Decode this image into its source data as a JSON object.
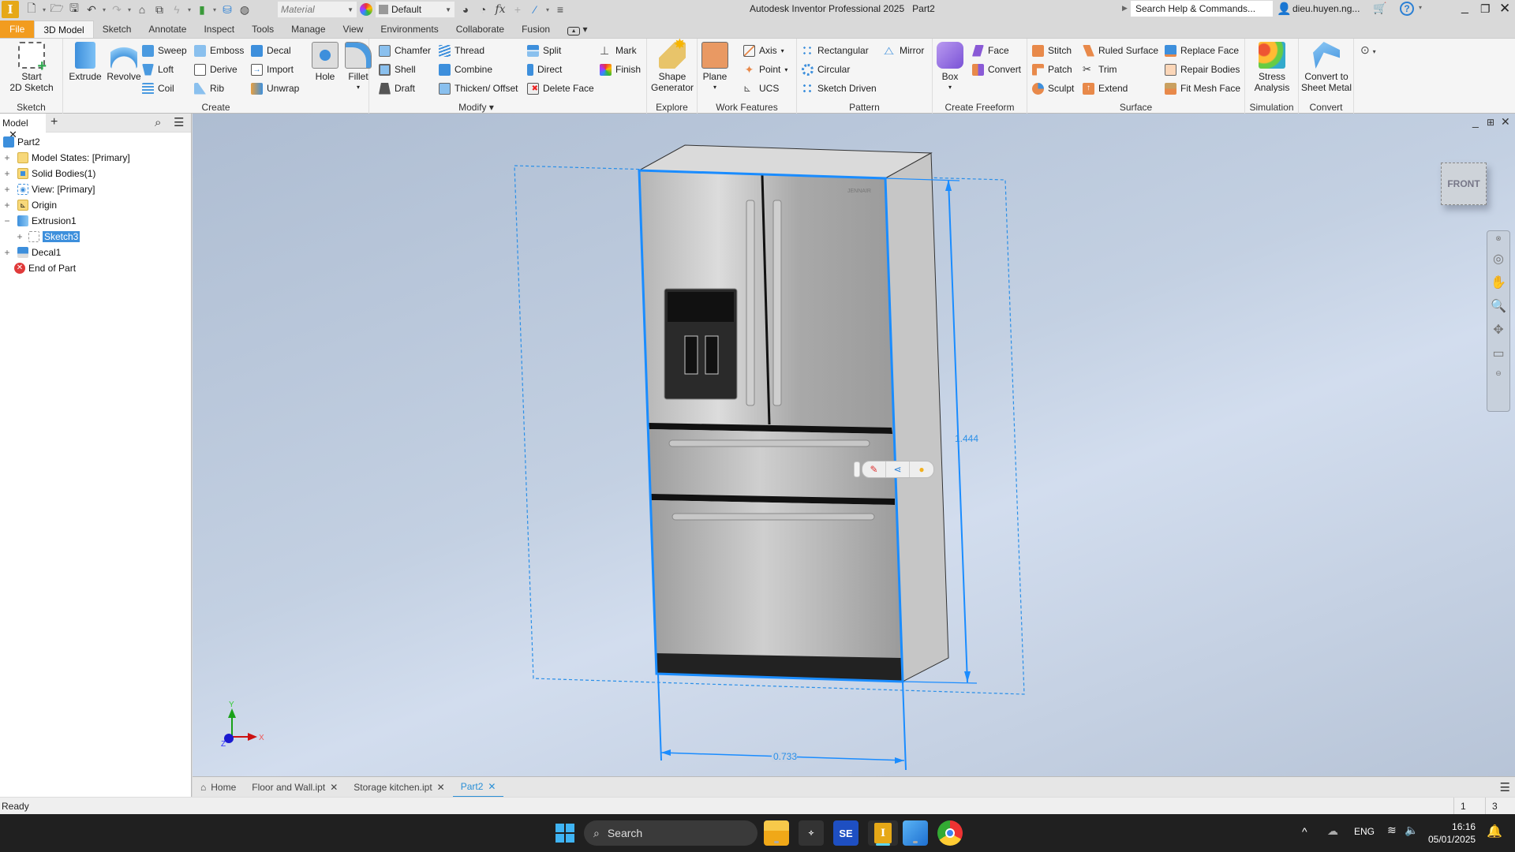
{
  "titlebar": {
    "app_title": "Autodesk Inventor Professional 2025",
    "doc_name": "Part2",
    "material_placeholder": "Material",
    "appearance_value": "Default",
    "help_search_placeholder": "Search Help & Commands...",
    "user_name": "dieu.huyen.ng...",
    "logo_letter": "I"
  },
  "ribbon_tabs": [
    "File",
    "3D Model",
    "Sketch",
    "Annotate",
    "Inspect",
    "Tools",
    "Manage",
    "View",
    "Environments",
    "Collaborate",
    "Fusion"
  ],
  "active_tab": "3D Model",
  "ribbon": {
    "sketch": {
      "title": "Sketch",
      "start_sketch": "Start\n2D Sketch"
    },
    "create": {
      "title": "Create",
      "extrude": "Extrude",
      "revolve": "Revolve",
      "sweep": "Sweep",
      "loft": "Loft",
      "coil": "Coil",
      "emboss": "Emboss",
      "derive": "Derive",
      "rib": "Rib",
      "decal": "Decal",
      "import": "Import",
      "unwrap": "Unwrap"
    },
    "modify": {
      "title": "Modify ▾",
      "hole": "Hole",
      "fillet": "Fillet",
      "chamfer": "Chamfer",
      "shell": "Shell",
      "draft": "Draft",
      "thread": "Thread",
      "combine": "Combine",
      "thicken": "Thicken/ Offset",
      "split": "Split",
      "direct": "Direct",
      "delete_face": "Delete Face",
      "mark": "Mark",
      "finish": "Finish"
    },
    "explore": {
      "title": "Explore",
      "shape_generator": "Shape\nGenerator"
    },
    "work_features": {
      "title": "Work Features",
      "plane": "Plane",
      "axis": "Axis",
      "point": "Point",
      "ucs": "UCS"
    },
    "pattern": {
      "title": "Pattern",
      "rectangular": "Rectangular",
      "circular": "Circular",
      "sketch_driven": "Sketch Driven",
      "mirror": "Mirror"
    },
    "freeform": {
      "title": "Create Freeform",
      "box": "Box",
      "face": "Face",
      "convert": "Convert"
    },
    "surface": {
      "title": "Surface",
      "stitch": "Stitch",
      "patch": "Patch",
      "sculpt": "Sculpt",
      "ruled_surface": "Ruled Surface",
      "trim": "Trim",
      "extend": "Extend",
      "replace_face": "Replace Face",
      "repair_bodies": "Repair Bodies",
      "fit_mesh_face": "Fit Mesh Face"
    },
    "simulation": {
      "title": "Simulation",
      "stress_analysis": "Stress\nAnalysis"
    },
    "convert": {
      "title": "Convert",
      "sheet_metal": "Convert to\nSheet Metal"
    }
  },
  "browser": {
    "tab_label": "Model",
    "items": [
      {
        "label": "Part2",
        "expander": ""
      },
      {
        "label": "Model States: [Primary]",
        "expander": "+"
      },
      {
        "label": "Solid Bodies(1)",
        "expander": "+"
      },
      {
        "label": "View: [Primary]",
        "expander": "+"
      },
      {
        "label": "Origin",
        "expander": "+"
      },
      {
        "label": "Extrusion1",
        "expander": "−"
      },
      {
        "label": "Sketch3",
        "expander": "+"
      },
      {
        "label": "Decal1",
        "expander": "+"
      },
      {
        "label": "End of Part",
        "expander": ""
      }
    ]
  },
  "viewport": {
    "dimension_height": "1.444",
    "dimension_width": "0.733",
    "viewcube_label": "FRONT",
    "brand_badge": "JENNAIR",
    "axis_x": "X",
    "axis_y": "Y",
    "axis_z": "Z"
  },
  "doc_tabs": [
    {
      "label": "Home",
      "closable": false
    },
    {
      "label": "Floor and Wall.ipt",
      "closable": true
    },
    {
      "label": "Storage kitchen.ipt",
      "closable": true
    },
    {
      "label": "Part2",
      "closable": true
    }
  ],
  "status": {
    "text": "Ready",
    "count1": "1",
    "count2": "3"
  },
  "taskbar": {
    "search_placeholder": "Search",
    "lang": "ENG",
    "time": "16:16",
    "date": "05/01/2025",
    "se_label": "SE",
    "inventor_label": "I"
  }
}
